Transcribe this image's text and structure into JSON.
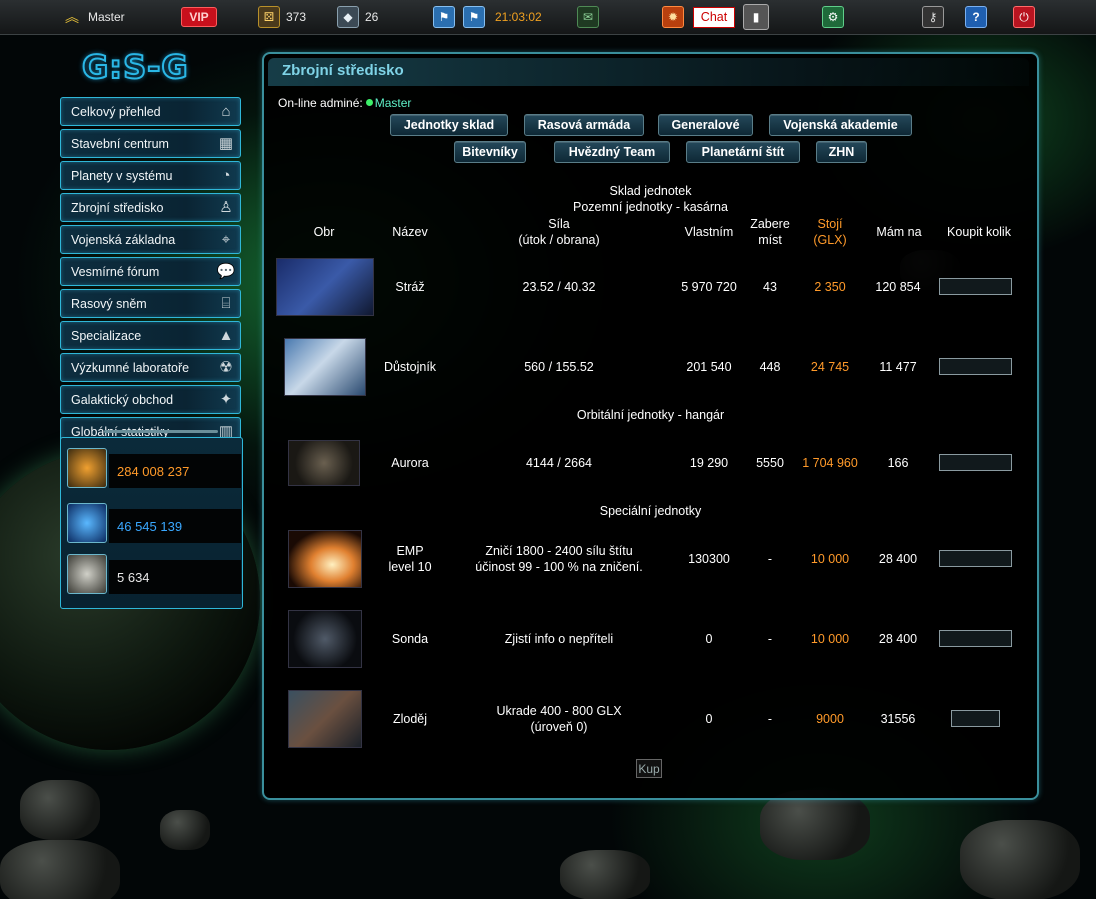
{
  "topbar": {
    "username": "Master",
    "vip_label": "VIP",
    "counter_a": "373",
    "counter_b": "26",
    "clock": "21:03:02",
    "chat_label": "Chat"
  },
  "logo_text": "G:S-G",
  "sidebar": {
    "items": [
      {
        "label": "Celkový přehled",
        "icon": "home-icon"
      },
      {
        "label": "Stavební centrum",
        "icon": "building-icon"
      },
      {
        "label": "Planety v systému",
        "icon": "planet-icon"
      },
      {
        "label": "Zbrojní středisko",
        "icon": "soldier-icon"
      },
      {
        "label": "Vojenská základna",
        "icon": "base-icon"
      },
      {
        "label": "Vesmírné fórum",
        "icon": "chat-bubbles-icon"
      },
      {
        "label": "Rasový sněm",
        "icon": "parliament-icon"
      },
      {
        "label": "Specializace",
        "icon": "shapes-icon"
      },
      {
        "label": "Výzkumné laboratoře",
        "icon": "radiation-icon"
      },
      {
        "label": "Galaktický obchod",
        "icon": "tag-icon"
      },
      {
        "label": "Globální statistiky",
        "icon": "bar-chart-icon"
      }
    ]
  },
  "resources": [
    {
      "value": "284 008 237",
      "color": "#ff9a2a",
      "icon": "mineral-icon"
    },
    {
      "value": "46 545 139",
      "color": "#3aa8ff",
      "icon": "energy-icon"
    },
    {
      "value": "5 634",
      "color": "#e8e8e8",
      "icon": "population-icon"
    }
  ],
  "panel": {
    "title": "Zbrojní středisko",
    "online_label": "On-line adminé:",
    "online_admin": "Master",
    "tabs_row1": [
      "Jednotky sklad",
      "Rasová armáda",
      "Generalové",
      "Vojenská akademie"
    ],
    "tabs_row2": [
      "Bitevníky",
      "Hvězdný Team",
      "Planetární štít",
      "ZHN"
    ],
    "section_main": "Sklad jednotek",
    "section_ground": "Pozemní jednotky - kasárna",
    "section_orbital": "Orbitální jednotky - hangár",
    "section_special": "Speciální jednotky",
    "headers": {
      "img": "Obr",
      "name": "Název",
      "power1": "Síla",
      "power2": "(útok / obrana)",
      "owned": "Vlastním",
      "space1": "Zabere",
      "space2": "míst",
      "cost1": "Stojí",
      "cost2": "(GLX)",
      "afford": "Mám na",
      "buy": "Koupit kolik"
    },
    "units": [
      {
        "name": "Stráž",
        "name2": "",
        "power": "23.52 / 40.32",
        "power2": "",
        "owned": "5 970 720",
        "space": "43",
        "cost": "2 350",
        "afford": "120 854"
      },
      {
        "name": "Důstojník",
        "name2": "",
        "power": "560 / 155.52",
        "power2": "",
        "owned": "201 540",
        "space": "448",
        "cost": "24 745",
        "afford": "11 477"
      },
      {
        "name": "Aurora",
        "name2": "",
        "power": "4144 / 2664",
        "power2": "",
        "owned": "19 290",
        "space": "5550",
        "cost": "1 704 960",
        "afford": "166"
      },
      {
        "name": "EMP",
        "name2": "level 10",
        "power": "Zničí 1800 - 2400 sílu štítu",
        "power2": "účinost 99 - 100 % na zničení.",
        "owned": "130300",
        "space": "-",
        "cost": "10 000",
        "afford": "28 400"
      },
      {
        "name": "Sonda",
        "name2": "",
        "power": "Zjistí info o nepříteli",
        "power2": "",
        "owned": "0",
        "space": "-",
        "cost": "10 000",
        "afford": "28 400"
      },
      {
        "name": "Zloděj",
        "name2": "",
        "power": "Ukrade 400 - 800 GLX",
        "power2": "(úroveň 0)",
        "owned": "0",
        "space": "-",
        "cost": "9000",
        "afford": "31556"
      }
    ],
    "buy_button": "Kup"
  }
}
